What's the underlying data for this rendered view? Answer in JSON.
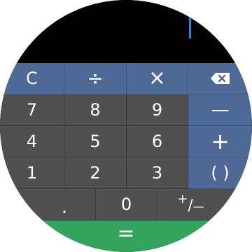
{
  "display": {
    "expression": ""
  },
  "keys": {
    "clear": "C",
    "divide": "÷",
    "multiply": "×",
    "backspace_icon": "backspace-icon",
    "seven": "7",
    "eight": "8",
    "nine": "9",
    "minus": "—",
    "four": "4",
    "five": "5",
    "six": "6",
    "plus": "+",
    "one": "1",
    "two": "2",
    "three": "3",
    "parens": "( )",
    "decimal": ".",
    "zero": "0",
    "plus_minus_plus": "+",
    "plus_minus_slash": "/",
    "plus_minus_minus": "—",
    "equals": "="
  },
  "colors": {
    "operator": "#4f6996",
    "number": "#505050",
    "equals": "#34a35d",
    "cursor": "#1e88e5"
  }
}
